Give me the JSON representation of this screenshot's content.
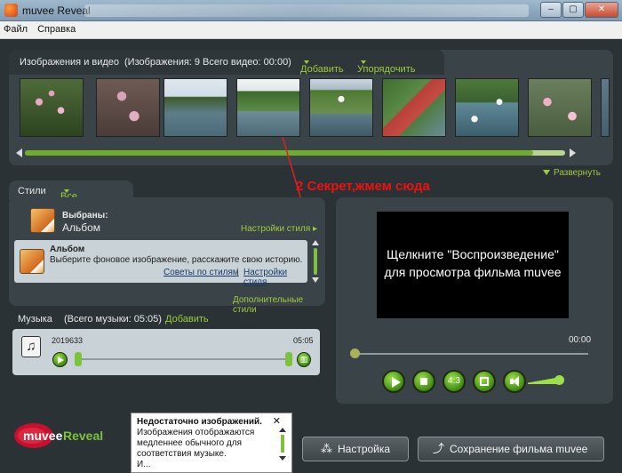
{
  "window": {
    "title": "muvee Reveal"
  },
  "menu": {
    "file": "Файл",
    "help": "Справка"
  },
  "media": {
    "header": "Изображения и видео",
    "counts": "(Изображения: 9",
    "videos": "Всего видео: 00:00)",
    "add": "Добавить",
    "arrange": "Упорядочить",
    "expand": "Развернуть",
    "scroll_fraction": 0.94
  },
  "annotation": "2 Секрет,жмем сюда",
  "styles": {
    "tab": "Стили",
    "all_styles": "Все стили",
    "selected_label": "Выбраны:",
    "selected_value": "Альбом",
    "settings_link": "Настройки стиля",
    "item_title": "Альбом",
    "item_desc": "Выберите фоновое изображение, расскажите свою историю.",
    "tips_link": "Советы по стилям",
    "style_settings_link": "Настройки стиля",
    "extra_styles": "Дополнительные стили"
  },
  "music": {
    "tab": "Музыка",
    "total": "(Всего музыки: 05:05)",
    "add": "Добавить",
    "track_name": "2019633",
    "track_duration": "05:05"
  },
  "preview": {
    "screen_line1": "Щелкните \"Воспроизведение\"",
    "screen_line2": "для просмотра фильма muvee",
    "time": "00:00",
    "aspect_label": "4:3"
  },
  "notice": {
    "title": "Недостаточно изображений.",
    "line1": "Изображения отображаются",
    "line2": "медленнее обычного для",
    "line3": "соответствия музыке.",
    "line4": "И..."
  },
  "bottom": {
    "settings": "Настройка",
    "save": "Сохранение фильма muvee",
    "logo_muvee": "muvee",
    "logo_reveal": "Reveal"
  }
}
